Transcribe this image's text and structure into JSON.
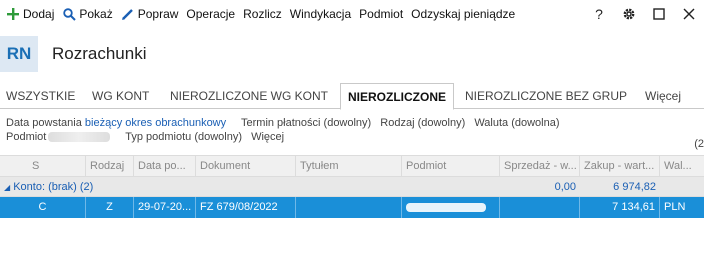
{
  "toolbar": {
    "items": [
      {
        "label": "Dodaj",
        "icon": "plus-icon"
      },
      {
        "label": "Pokaż",
        "icon": "search-icon"
      },
      {
        "label": "Popraw",
        "icon": "pencil-icon"
      },
      {
        "label": "Operacje"
      },
      {
        "label": "Rozlicz"
      },
      {
        "label": "Windykacja"
      },
      {
        "label": "Podmiot"
      },
      {
        "label": "Odzyskaj pieniądze"
      }
    ],
    "right_icons": [
      "help-icon",
      "gear-icon",
      "maximize-icon",
      "close-icon"
    ],
    "help_glyph": "?"
  },
  "header": {
    "badge": "RN",
    "title": "Rozrachunki"
  },
  "tabs": [
    "WSZYSTKIE",
    "WG KONT",
    "NIEROZLICZONE WG KONT",
    "NIEROZLICZONE",
    "NIEROZLICZONE BEZ GRUP",
    "Więcej"
  ],
  "active_tab": "NIEROZLICZONE",
  "filters": {
    "row1": [
      {
        "prefix": "Data powstania ",
        "value": "bieżący okres obrachunkowy"
      },
      {
        "text": "Termin płatności (dowolny)"
      },
      {
        "text": "Rodzaj (dowolny)"
      },
      {
        "text": "Waluta (dowolna)"
      }
    ],
    "row2": [
      {
        "text": "Podmiot"
      },
      {
        "text": "Typ podmiotu (dowolny)"
      },
      {
        "text": "Więcej"
      }
    ],
    "count": "(2"
  },
  "grid": {
    "columns": [
      "S",
      "Rodzaj",
      "Data po...",
      "Dokument",
      "Tytułem",
      "Podmiot",
      "Sprzedaż - w...",
      "Zakup - wart...",
      "Wal..."
    ],
    "group": {
      "label": "Konto: (brak) (2)",
      "sales": "0,00",
      "purchase": "6 974,82"
    },
    "rows": [
      {
        "s": "C",
        "rodzaj": "Z",
        "data": "29-07-20...",
        "dokument": "FZ 679/08/2022",
        "tytulem": "",
        "podmiot": "",
        "sprzedaz": "",
        "zakup": "7 134,61",
        "waluta": "PLN"
      }
    ]
  },
  "colors": {
    "accent": "#1a8fd8",
    "badge_bg": "#dde8f3",
    "badge_fg": "#1b6fb5",
    "link": "#1a5fb4"
  }
}
